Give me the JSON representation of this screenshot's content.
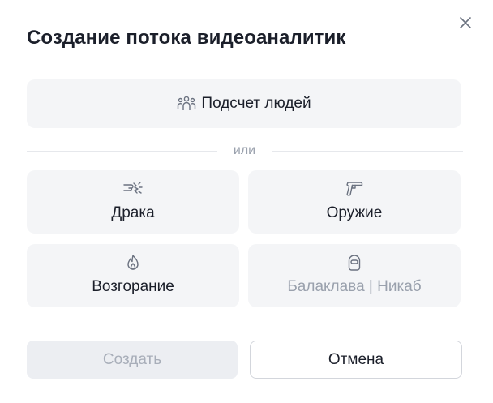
{
  "dialog": {
    "title": "Создание потока видеоаналитик",
    "close_icon": "close-icon"
  },
  "options": {
    "people_count": {
      "label": "Подсчет людей",
      "icon": "people-group-icon"
    },
    "divider_text": "или",
    "tiles": [
      {
        "label": "Драка",
        "icon": "fight-icon",
        "disabled": false
      },
      {
        "label": "Оружие",
        "icon": "gun-icon",
        "disabled": false
      },
      {
        "label": "Возгорание",
        "icon": "fire-icon",
        "disabled": false
      },
      {
        "label": "Балаклава | Никаб",
        "icon": "balaclava-icon",
        "disabled": true
      }
    ]
  },
  "footer": {
    "create_label": "Создать",
    "cancel_label": "Отмена"
  },
  "colors": {
    "tile_bg": "#f4f5f7",
    "text_primary": "#1b1f2a",
    "text_muted": "#9aa1ad",
    "icon_color": "#6b7280"
  }
}
